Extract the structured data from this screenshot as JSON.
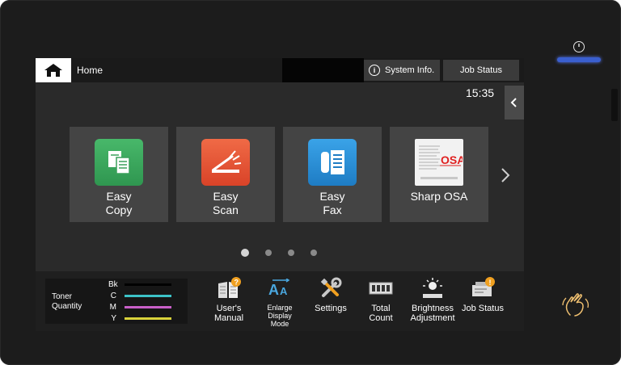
{
  "header": {
    "home_label": "Home",
    "system_info_label": "System Info.",
    "job_status_label": "Job Status",
    "time": "15:35"
  },
  "tiles": [
    {
      "line1": "Easy",
      "line2": "Copy",
      "icon": "copy-icon",
      "color": "#3aa05a"
    },
    {
      "line1": "Easy",
      "line2": "Scan",
      "icon": "scan-icon",
      "color": "#e8543a"
    },
    {
      "line1": "Easy",
      "line2": "Fax",
      "icon": "fax-icon",
      "color": "#2a8fd6"
    },
    {
      "line1": "Sharp OSA",
      "line2": "",
      "icon": "osa-logo-icon",
      "color": "#f2f2f2"
    }
  ],
  "pager": {
    "pages": 4,
    "active": 1
  },
  "toner": {
    "title_line1": "Toner",
    "title_line2": "Quantity",
    "rows": [
      {
        "label": "Bk",
        "color": "#000000"
      },
      {
        "label": "C",
        "color": "#3cc3c8"
      },
      {
        "label": "M",
        "color": "#c85fc8"
      },
      {
        "label": "Y",
        "color": "#d8d23a"
      }
    ]
  },
  "functions": [
    {
      "line1": "User's",
      "line2": "Manual",
      "line3": "",
      "icon": "manual-icon"
    },
    {
      "line1": "Enlarge",
      "line2": "Display",
      "line3": "Mode",
      "icon": "enlarge-text-icon"
    },
    {
      "line1": "Settings",
      "line2": "",
      "line3": "",
      "icon": "tools-icon"
    },
    {
      "line1": "Total",
      "line2": "Count",
      "line3": "",
      "icon": "counter-icon"
    },
    {
      "line1": "Brightness",
      "line2": "Adjustment",
      "line3": "",
      "icon": "brightness-icon"
    },
    {
      "line1": "Job Status",
      "line2": "",
      "line3": "",
      "icon": "job-status-icon"
    }
  ],
  "colors": {
    "led": "#3a5fcf",
    "badge": "#f0a020"
  }
}
